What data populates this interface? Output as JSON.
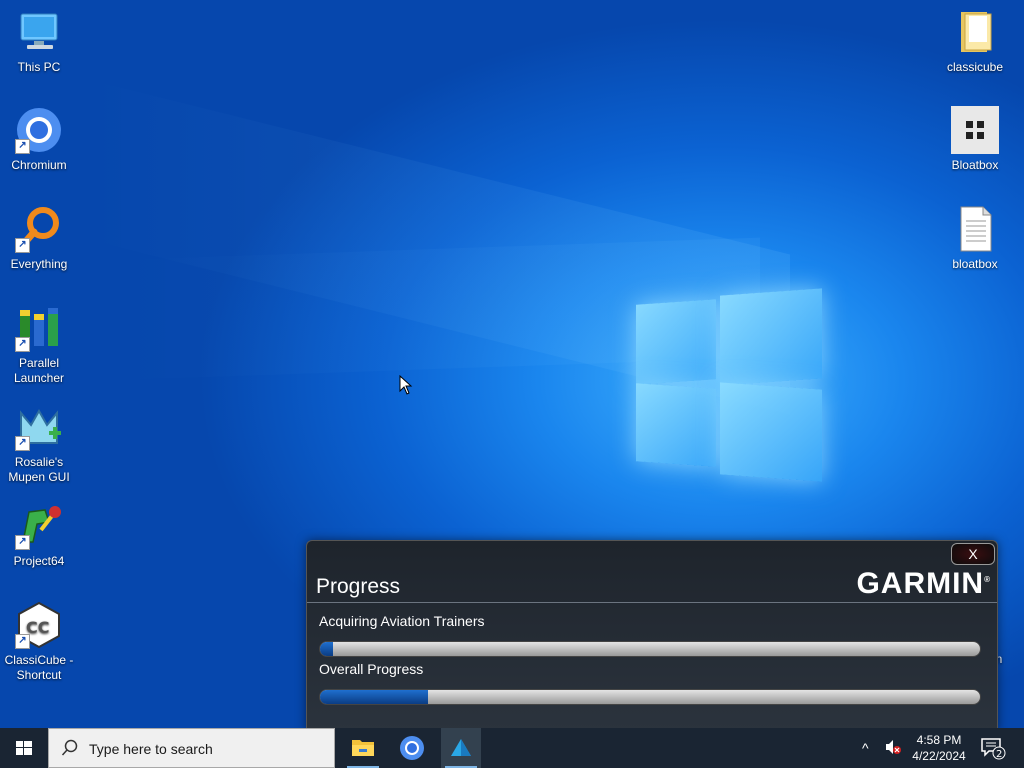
{
  "desktop": {
    "left_icons": [
      {
        "label": "This PC",
        "icon": "computer-icon"
      },
      {
        "label": "Chromium",
        "icon": "chromium-icon"
      },
      {
        "label": "Everything",
        "icon": "everything-search-icon"
      },
      {
        "label": "Parallel Launcher",
        "icon": "parallel-launcher-icon"
      },
      {
        "label": "Rosalie's Mupen GUI",
        "icon": "mupen-icon"
      },
      {
        "label": "Project64",
        "icon": "project64-icon"
      },
      {
        "label": "ClassiCube - Shortcut",
        "icon": "classicube-icon"
      }
    ],
    "right_icons": [
      {
        "label": "classicube",
        "icon": "folder-icon"
      },
      {
        "label": "Bloatbox",
        "icon": "bloatbox-app-icon"
      },
      {
        "label": "bloatbox",
        "icon": "text-file-icon"
      }
    ],
    "partial_label": "in"
  },
  "garmin_dialog": {
    "close_label": "X",
    "title": "Progress",
    "brand": "GARMIN",
    "brand_mark": "®",
    "task_label": "Acquiring Aviation Trainers",
    "task_progress": 0.02,
    "overall_label": "Overall Progress",
    "overall_progress": 0.163
  },
  "taskbar": {
    "search_placeholder": "Type here to search",
    "apps": [
      {
        "name": "File Explorer",
        "icon": "file-explorer-icon"
      },
      {
        "name": "Chromium",
        "icon": "chromium-icon"
      },
      {
        "name": "Garmin",
        "icon": "garmin-app-icon",
        "active": true
      }
    ],
    "time": "4:58 PM",
    "date": "4/22/2024",
    "notification_count": "2"
  },
  "colors": {
    "accent": "#0b62d2",
    "progress_fill": "#1f6fcf",
    "taskbar": "#1a2533"
  }
}
